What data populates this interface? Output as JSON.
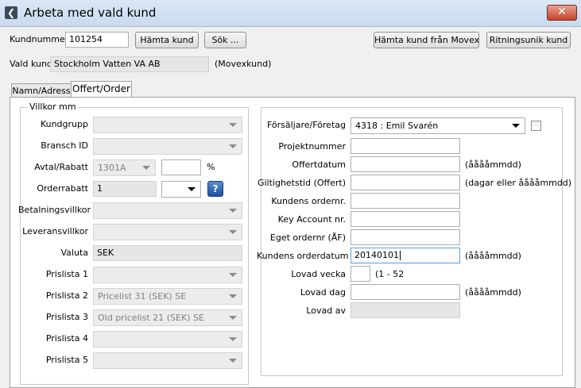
{
  "window": {
    "title": "Arbeta med vald kund"
  },
  "toolbar": {
    "kundnummer_label": "Kundnummer",
    "kundnummer_value": "101254",
    "hamta_kund": "Hämta kund",
    "sok": "Sök ...",
    "hamta_movex": "Hämta kund från Movex",
    "ritningsunik": "Ritningsunik kund",
    "vald_kund_label": "Vald kund",
    "vald_kund_value": "Stockholm Vatten VA AB",
    "vald_kund_note": "(Movexkund)"
  },
  "tabs": [
    {
      "label": "Namn/Adress",
      "active": false
    },
    {
      "label": "Offert/Order",
      "active": true
    }
  ],
  "villkor": {
    "group_label": "Villkor mm",
    "kundgrupp": {
      "label": "Kundgrupp",
      "value": ""
    },
    "bransch": {
      "label": "Bransch ID",
      "value": ""
    },
    "avtal": {
      "label": "Avtal/Rabatt",
      "value": "1301A",
      "rabatt": "",
      "unit": "%"
    },
    "orderrabatt": {
      "label": "Orderrabatt",
      "value": "1",
      "combo": ""
    },
    "betalning": {
      "label": "Betalningsvillkor",
      "value": ""
    },
    "leverans": {
      "label": "Leveransvillkor",
      "value": ""
    },
    "valuta": {
      "label": "Valuta",
      "value": "SEK"
    },
    "prislista1": {
      "label": "Prislista 1",
      "value": ""
    },
    "prislista2": {
      "label": "Prislista 2",
      "value": "Pricelist 31 (SEK) SE"
    },
    "prislista3": {
      "label": "Prislista 3",
      "value": "Old pricelist 21 (SEK) SE"
    },
    "prislista4": {
      "label": "Prislista 4",
      "value": ""
    },
    "prislista5": {
      "label": "Prislista 5",
      "value": ""
    }
  },
  "order": {
    "forsaljare": {
      "label": "Försäljare/Företag",
      "value": "4318 : Emil Svarén"
    },
    "projektnummer": {
      "label": "Projektnummer",
      "value": ""
    },
    "offertdatum": {
      "label": "Offertdatum",
      "value": "",
      "hint": "(ååååmmdd)"
    },
    "giltighetstid": {
      "label": "Giltighetstid (Offert)",
      "value": "",
      "hint": "(dagar eller ååååmmdd)"
    },
    "kundens_ordernr": {
      "label": "Kundens ordernr.",
      "value": ""
    },
    "key_account": {
      "label": "Key Account nr.",
      "value": ""
    },
    "eget_ordernr": {
      "label": "Eget ordernr (ÅF)",
      "value": ""
    },
    "kundens_orderdatum": {
      "label": "Kundens orderdatum",
      "value": "20140101",
      "hint": "(ååååmmdd)"
    },
    "lovad_vecka": {
      "label": "Lovad vecka",
      "value": "",
      "hint": "(1 - 52"
    },
    "lovad_dag": {
      "label": "Lovad dag",
      "value": "",
      "hint": "(ååååmmdd)"
    },
    "lovad_av": {
      "label": "Lovad av",
      "value": ""
    }
  },
  "icons": {
    "app": "back-arrow-icon",
    "close": "close-icon",
    "help": "help-icon",
    "dropdown": "chevron-down-icon"
  },
  "colors": {
    "titlebar": "#c9daf0",
    "close": "#c8432b",
    "help": "#1f4f9a"
  }
}
